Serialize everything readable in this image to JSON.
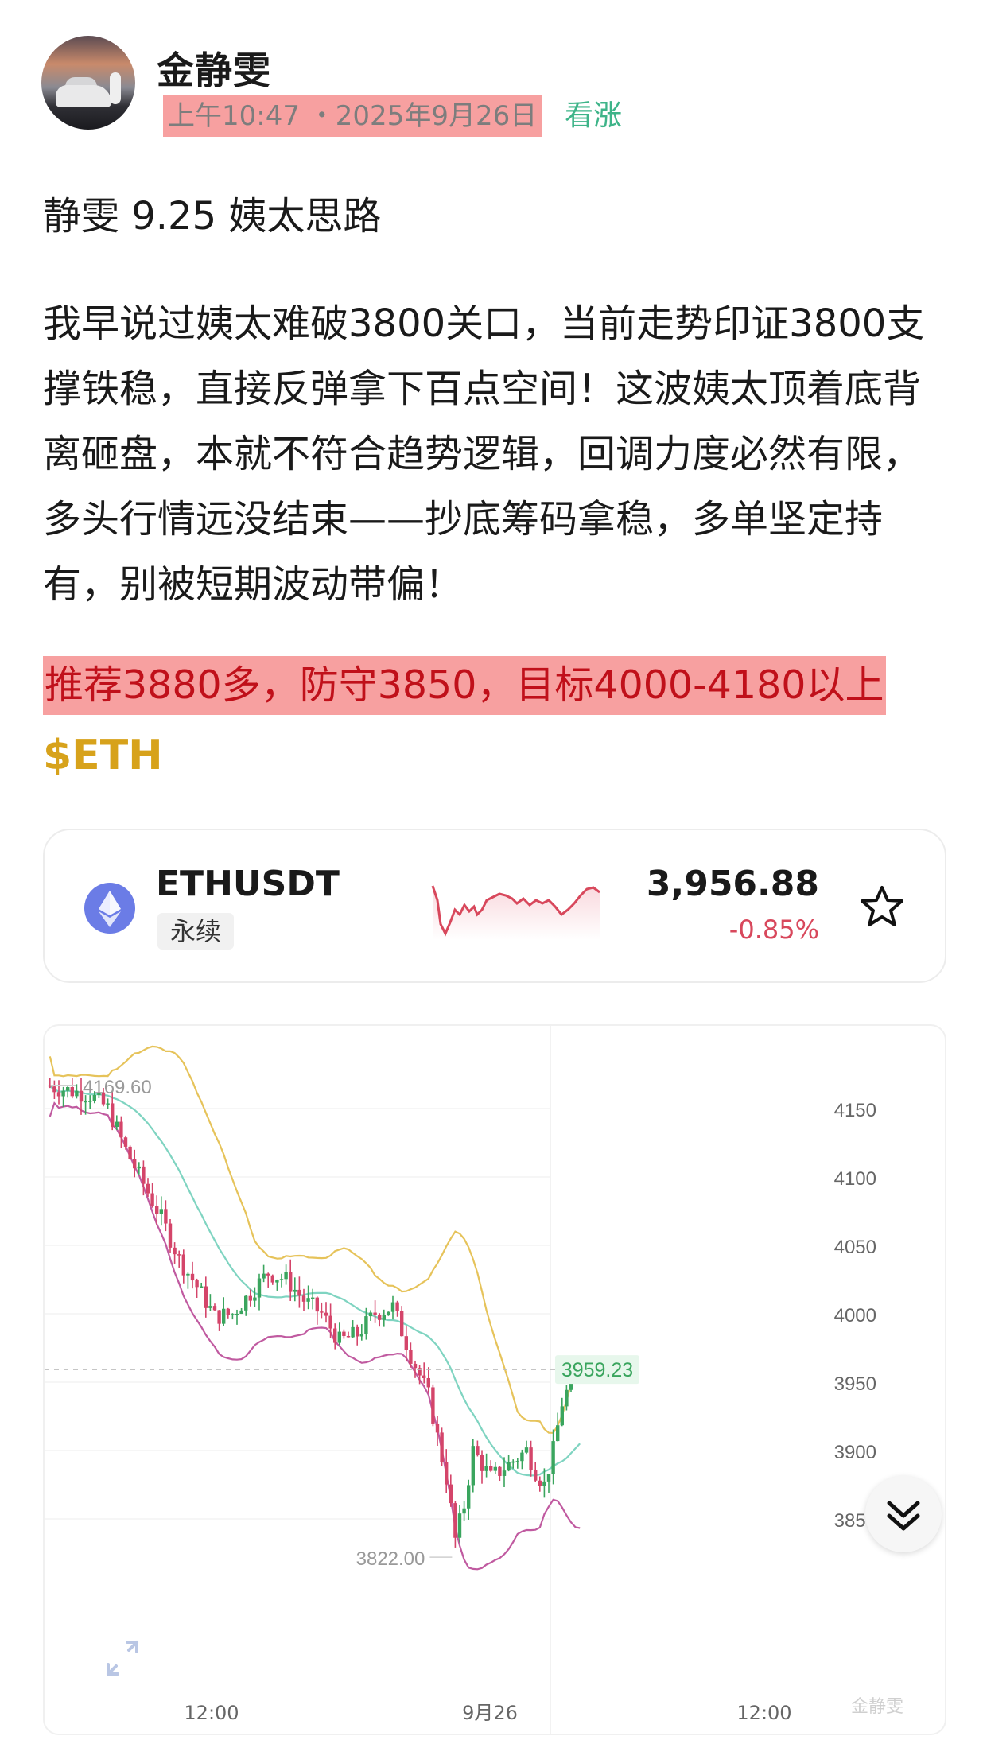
{
  "post": {
    "author": "金静雯",
    "time": "上午10:47 ・2025年9月26日",
    "tag": "看涨",
    "title": "静雯 9.25 姨太思路",
    "body": "我早说过姨太难破3800关口，当前走势印证3800支撑铁稳，直接反弹拿下百点空间！这波姨太顶着底背离砸盘，本就不符合趋势逻辑，回调力度必然有限，多头行情远没结束——抄底筹码拿稳，多单坚定持有，别被短期波动带偏！",
    "highlight": "推荐3880多，防守3850，目标4000-4180以上",
    "cashtag": "$ETH"
  },
  "ticker": {
    "symbol": "ETHUSDT",
    "contract": "永续",
    "price": "3,956.88",
    "change": "-0.85%",
    "coin_icon": "ethereum-icon",
    "star_icon": "star-icon",
    "down_color": "#d8485c"
  },
  "chart_data": {
    "type": "candlestick",
    "y_ticks": [
      "4150",
      "4100",
      "4050",
      "4000",
      "3950",
      "3900",
      "3850"
    ],
    "x_ticks": [
      "12:00",
      "9月26",
      "12:00"
    ],
    "high_label": "4169.60",
    "low_label": "3822.00",
    "last_price_label": "3959.23",
    "ylim": [
      3815,
      4188
    ],
    "colors": {
      "up": "#3aa55e",
      "down": "#d4456a",
      "upper_band": "#e6c35a",
      "middle_band": "#7fd4c1",
      "lower_band": "#c05aa0",
      "last_price": "#3aa55e"
    }
  },
  "watermark": "金静雯",
  "controls": {
    "expand_icon": "expand-icon",
    "scroll_down_icon": "double-chevron-down-icon"
  }
}
